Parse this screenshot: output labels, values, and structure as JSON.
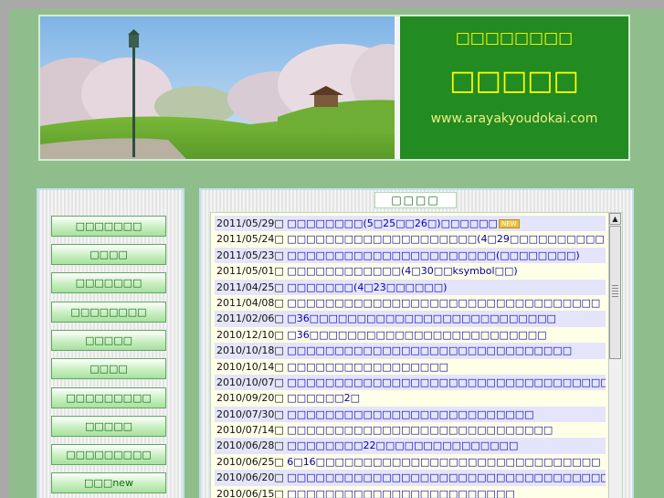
{
  "header": {
    "subtitle": "□□□□□□□□",
    "title": "□□□□□",
    "url": "www.arayakyoudokai.com"
  },
  "sidebar": {
    "items": [
      {
        "label": "□□□□□□□"
      },
      {
        "label": "□□□□"
      },
      {
        "label": "□□□□□□□"
      },
      {
        "label": "□□□□□□□□"
      },
      {
        "label": "□□□□□"
      },
      {
        "label": "□□□□"
      },
      {
        "label": "□□□□□□□□□"
      },
      {
        "label": "□□□□□"
      },
      {
        "label": "□□□□□□□□□"
      },
      {
        "label": "□□□new"
      }
    ]
  },
  "news": {
    "heading": "□□□□",
    "new_badge": "NEW",
    "items": [
      {
        "date": "2011/05/29□",
        "title": "□□□□□□□□(5□25□□26□)□□□□□□"
      },
      {
        "date": "2011/05/24□",
        "title": "□□□□□□□□□□□□□□□□□□□□(4□29□□□□□□□□□□)"
      },
      {
        "date": "2011/05/23□",
        "title": "□□□□□□□□□□□□□□□□□□□□□□(□□□□□□□□)"
      },
      {
        "date": "2011/05/01□",
        "title": "□□□□□□□□□□□□(4□30□□ksymbol□□)"
      },
      {
        "date": "2011/04/25□",
        "title": "□□□□□□□(4□23□□□□□□)"
      },
      {
        "date": "2011/04/08□",
        "title": "□□□□□□□□□□□□□□□□□□□□□□□□□□□□□□□□□"
      },
      {
        "date": "2011/02/06□",
        "title": "□36□□□□□□□□□□□□□□□□□□□□□□□□□□"
      },
      {
        "date": "2010/12/10□",
        "title": "□36□□□□□□□□□□□□□□□□□□□□□□□□□"
      },
      {
        "date": "2010/10/18□",
        "title": "□□□□□□□□□□□□□□□□□□□□□□□□□□□□□□"
      },
      {
        "date": "2010/10/14□",
        "title": "□□□□□□□□□□□□□□□□□"
      },
      {
        "date": "2010/10/07□",
        "title": "□□□□□□□□□□□□□□□□□□□□□□□□□□□□□□□□□□□□"
      },
      {
        "date": "2010/09/20□",
        "title": "□□□□□□2□"
      },
      {
        "date": "2010/07/30□",
        "title": "□□□□□□□□□□□□□□□□□□□□□□□□□□"
      },
      {
        "date": "2010/07/14□",
        "title": "□□□□□□□□□□□□□□□□□□□□□□□□□□□□"
      },
      {
        "date": "2010/06/28□",
        "title": "□□□□□□□□22□□□□□□□□□□□□□□□"
      },
      {
        "date": "2010/06/25□",
        "title": "6□16□□□□□□□□□□□□□□□□□□□□□□□□□□□□□□"
      },
      {
        "date": "2010/06/20□",
        "title": "□□□□□□□□□□□□□□□□□□□□□□□□□□□□□□□□□□□□"
      },
      {
        "date": "2010/06/15□",
        "title": "□□□□□□□□□□□□□□□□□□□□□□□□"
      }
    ]
  },
  "colors": {
    "page_bg": "#8fbe8c",
    "header_bg": "#228b22",
    "accent_yellow": "#ffff00",
    "link_blue": "#0000aa",
    "nav_text": "#116611"
  }
}
